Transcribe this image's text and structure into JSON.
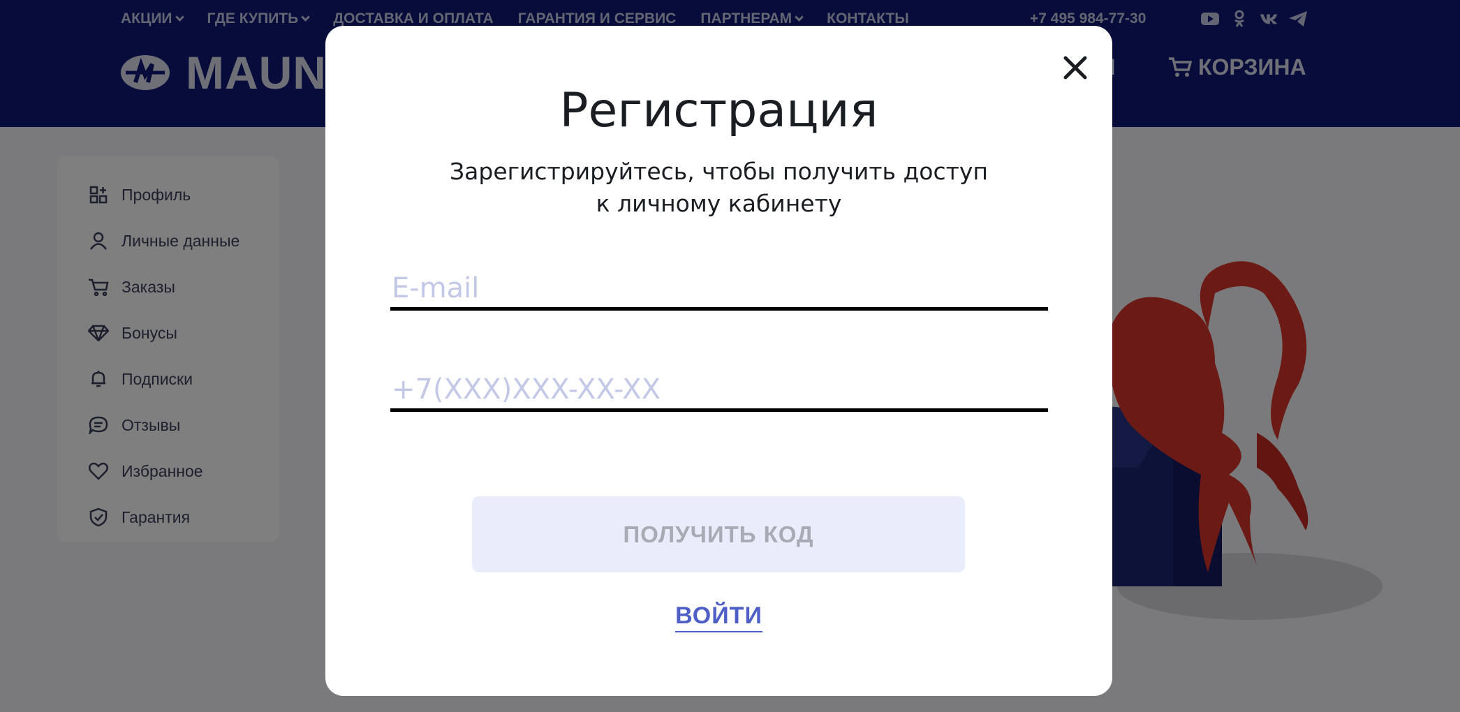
{
  "header": {
    "nav": [
      {
        "label": "АКЦИИ",
        "dropdown": true
      },
      {
        "label": "ГДЕ КУПИТЬ",
        "dropdown": true
      },
      {
        "label": "ДОСТАВКА И ОПЛАТА",
        "dropdown": false
      },
      {
        "label": "ГАРАНТИЯ И СЕРВИС",
        "dropdown": false
      },
      {
        "label": "ПАРТНЕРАМ",
        "dropdown": true
      },
      {
        "label": "КОНТАКТЫ",
        "dropdown": false
      }
    ],
    "phone": "+7 495 984-77-30",
    "socials": [
      "youtube-icon",
      "odnoklassniki-icon",
      "vk-icon",
      "telegram-icon"
    ],
    "logo_text": "MAUN",
    "right_fragment": "ТИ",
    "cart_label": "КОРЗИНА"
  },
  "sidebar": {
    "items": [
      {
        "label": "Профиль",
        "icon": "dashboard-icon"
      },
      {
        "label": "Личные данные",
        "icon": "user-icon"
      },
      {
        "label": "Заказы",
        "icon": "cart-icon"
      },
      {
        "label": "Бонусы",
        "icon": "diamond-icon"
      },
      {
        "label": "Подписки",
        "icon": "bell-icon"
      },
      {
        "label": "Отзывы",
        "icon": "chat-icon"
      },
      {
        "label": "Избранное",
        "icon": "heart-icon"
      },
      {
        "label": "Гарантия",
        "icon": "shield-icon"
      }
    ]
  },
  "modal": {
    "title": "Регистрация",
    "subtitle_line1": "Зарегистрируйтесь, чтобы получить доступ",
    "subtitle_line2": "к личному кабинету",
    "email_placeholder": "E-mail",
    "email_value": "",
    "phone_placeholder": "+7(XXX)XXX-XX-XX",
    "phone_value": "",
    "submit_label": "ПОЛУЧИТЬ КОД",
    "login_label": "ВОЙТИ"
  },
  "colors": {
    "header_bg": "#0f1877",
    "accent": "#4f5fc6",
    "button_bg": "#e9ecfa",
    "illustration_red": "#d8342a",
    "illustration_navy": "#1b2470"
  }
}
